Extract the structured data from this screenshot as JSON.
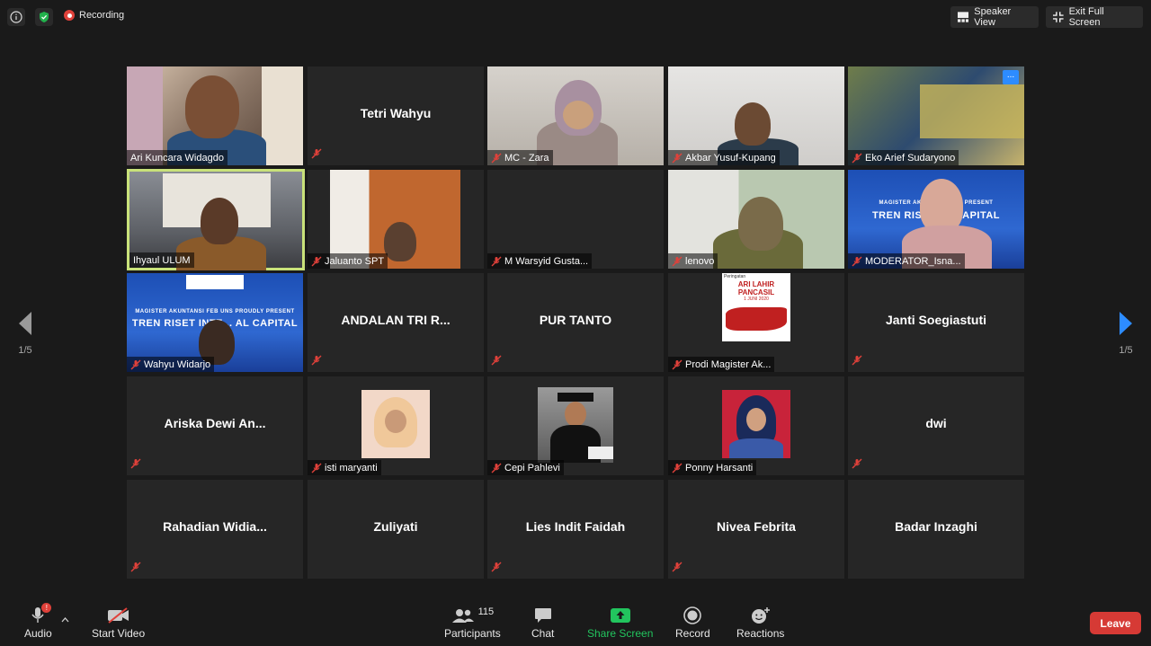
{
  "topbar": {
    "recording_label": "Recording",
    "speaker_view_label": "Speaker View",
    "exit_fullscreen_label": "Exit Full Screen"
  },
  "participants_grid": [
    {
      "name": "Ari Kuncara Widagdo",
      "video": true,
      "muted": false
    },
    {
      "name": "Tetri Wahyu",
      "video": false,
      "muted": true
    },
    {
      "name": "MC - Zara",
      "video": true,
      "muted": true
    },
    {
      "name": "Akbar Yusuf-Kupang",
      "video": true,
      "muted": true
    },
    {
      "name": "Eko Arief Sudaryono",
      "video": true,
      "muted": true,
      "more_button": "..."
    },
    {
      "name": "Ihyaul ULUM",
      "video": true,
      "muted": false,
      "active_speaker": true
    },
    {
      "name": "Jaluanto SPT",
      "video": true,
      "muted": true
    },
    {
      "name": "M Warsyid Gusta...",
      "video": false,
      "muted": true
    },
    {
      "name": "lenovo",
      "video": true,
      "muted": true
    },
    {
      "name": "MODERATOR_Isna...",
      "video": true,
      "muted": true,
      "banner": "TREN RISET I... CAPITAL",
      "banner_top": "MAGISTER AKU... PROUDLY PRESENT"
    },
    {
      "name": "Wahyu Widarjo",
      "video": true,
      "muted": true,
      "banner": "TREN RISET INTE... AL CAPITAL",
      "banner_top": "MAGISTER AKUNTANSI FEB UNS PROUDLY PRESENT"
    },
    {
      "name": "ANDALAN TRI R...",
      "video": false,
      "muted": true
    },
    {
      "name": "PUR TANTO",
      "video": false,
      "muted": true
    },
    {
      "name": "Prodi Magister Ak...",
      "video": true,
      "muted": true,
      "banner": "ARI LAHIR PANCASIL",
      "banner_top": "Peringatan",
      "banner_sub": "1 JUNI 2020"
    },
    {
      "name": "Janti Soegiastuti",
      "video": false,
      "muted": true
    },
    {
      "name": "Ariska Dewi An...",
      "video": false,
      "muted": true
    },
    {
      "name": "isti maryanti",
      "video": false,
      "muted": true,
      "photo": true
    },
    {
      "name": "Cepi Pahlevi",
      "video": false,
      "muted": true,
      "photo": true
    },
    {
      "name": "Ponny Harsanti",
      "video": false,
      "muted": true,
      "photo": true
    },
    {
      "name": "dwi",
      "video": false,
      "muted": true
    },
    {
      "name": "Rahadian Widia...",
      "video": false,
      "muted": true
    },
    {
      "name": "Zuliyati",
      "video": false,
      "muted": false
    },
    {
      "name": "Lies Indit Faidah",
      "video": false,
      "muted": true
    },
    {
      "name": "Nivea Febrita",
      "video": false,
      "muted": true
    },
    {
      "name": "Badar Inzaghi",
      "video": false,
      "muted": false
    }
  ],
  "pagination": {
    "left": "1/5",
    "right": "1/5"
  },
  "toolbar": {
    "audio_label": "Audio",
    "audio_badge": "!",
    "video_label": "Start Video",
    "participants_label": "Participants",
    "participants_count": "115",
    "chat_label": "Chat",
    "share_label": "Share Screen",
    "record_label": "Record",
    "reactions_label": "Reactions",
    "leave_label": "Leave"
  },
  "colors": {
    "background": "#1a1a1a",
    "tile": "#262626",
    "active_outline": "#c9e27a",
    "share_green": "#22c55e",
    "leave_red": "#d63a35",
    "nav_blue": "#2d8cff",
    "mute_red": "#e0413a"
  }
}
